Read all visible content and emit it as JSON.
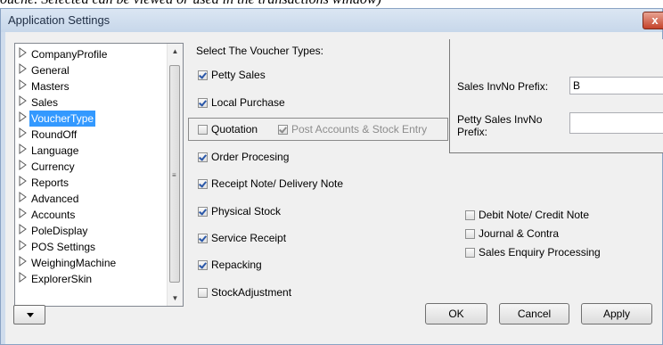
{
  "caption": "ouche. Selected can be viewed or used in the transactions window)",
  "window": {
    "title": "Application Settings",
    "close_symbol": "x"
  },
  "tree": {
    "items": [
      {
        "label": "CompanyProfile",
        "selected": false
      },
      {
        "label": "General",
        "selected": false
      },
      {
        "label": "Masters",
        "selected": false
      },
      {
        "label": "Sales",
        "selected": false
      },
      {
        "label": "VoucherType",
        "selected": true
      },
      {
        "label": "RoundOff",
        "selected": false
      },
      {
        "label": "Language",
        "selected": false
      },
      {
        "label": "Currency",
        "selected": false
      },
      {
        "label": "Reports",
        "selected": false
      },
      {
        "label": "Advanced",
        "selected": false
      },
      {
        "label": "Accounts",
        "selected": false
      },
      {
        "label": "PoleDisplay",
        "selected": false
      },
      {
        "label": "POS Settings",
        "selected": false
      },
      {
        "label": "WeighingMachine",
        "selected": false
      },
      {
        "label": "ExplorerSkin",
        "selected": false
      }
    ],
    "scroll_up": "▲",
    "scroll_down": "▼",
    "grip": "≡"
  },
  "voucher_group": {
    "title": "Select The Voucher Types:",
    "petty_sales": {
      "label": "Petty Sales",
      "checked": true
    },
    "local_purchase": {
      "label": "Local Purchase",
      "checked": true
    },
    "quotation": {
      "label": "Quotation",
      "checked": false
    },
    "post_accounts": {
      "label": "Post Accounts & Stock Entry",
      "checked": true,
      "disabled": true
    },
    "order_processing": {
      "label": "Order Procesing",
      "checked": true
    },
    "receipt_note": {
      "label": "Receipt Note/ Delivery Note",
      "checked": true
    },
    "physical_stock": {
      "label": "Physical Stock",
      "checked": true
    },
    "service_receipt": {
      "label": "Service Receipt",
      "checked": true
    },
    "repacking": {
      "label": "Repacking",
      "checked": true
    },
    "stock_adjustment": {
      "label": "StockAdjustment",
      "checked": false
    },
    "debit_note": {
      "label": "Debit Note/ Credit Note",
      "checked": false
    },
    "journal_contra": {
      "label": "Journal & Contra",
      "checked": false
    },
    "sales_enquiry": {
      "label": "Sales Enquiry Processing",
      "checked": false
    }
  },
  "prefix": {
    "sales_label": "Sales InvNo Prefix:",
    "sales_value": "B",
    "petty_label_line1": "Petty Sales InvNo",
    "petty_label_line2": "Prefix:",
    "petty_value": ""
  },
  "buttons": {
    "ok": "OK",
    "cancel": "Cancel",
    "apply": "Apply"
  }
}
